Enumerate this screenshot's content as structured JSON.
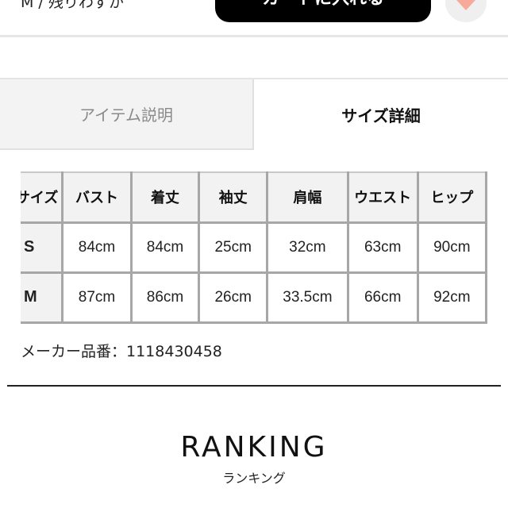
{
  "top_bar": {
    "stock_text": "M / 残りわずか",
    "cart_button_label": "カートに入れる",
    "favorite_icon": "heart-icon",
    "favorite_color": "#f7a99a"
  },
  "tabs": [
    {
      "label": "アイテム説明",
      "active": false
    },
    {
      "label": "サイズ詳細",
      "active": true
    }
  ],
  "size_table": {
    "headers": [
      "サイズ",
      "バスト",
      "着丈",
      "袖丈",
      "肩幅",
      "ウエスト",
      "ヒップ"
    ],
    "rows": [
      {
        "size": "S",
        "values": [
          "84cm",
          "84cm",
          "25cm",
          "32cm",
          "63cm",
          "90cm"
        ]
      },
      {
        "size": "M",
        "values": [
          "87cm",
          "86cm",
          "26cm",
          "33.5cm",
          "66cm",
          "92cm"
        ]
      }
    ]
  },
  "maker_code": "メーカー品番：1118430458",
  "ranking": {
    "title": "RANKING",
    "subtitle": "ランキング"
  }
}
